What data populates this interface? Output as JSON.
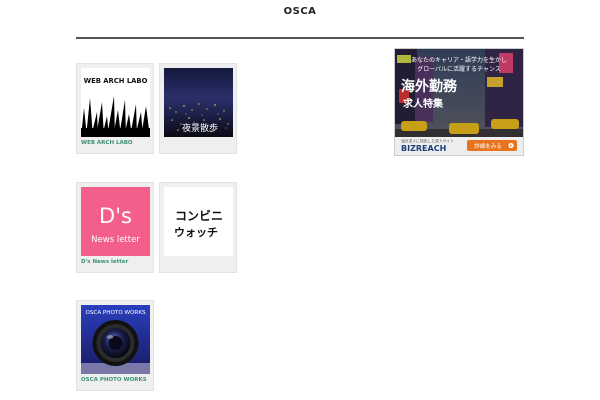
{
  "site": {
    "title": "OSCA"
  },
  "cards": [
    {
      "caption": "WEB ARCH LABO",
      "thumb_text": "WEB ARCH LABO"
    },
    {
      "caption": "",
      "thumb_text": "夜景散歩"
    },
    {
      "caption": "D's News letter",
      "thumb_big": "D's",
      "thumb_small": "News letter"
    },
    {
      "caption": "",
      "thumb_line1": "コンビニ",
      "thumb_line2": "ウォッチ"
    },
    {
      "caption": "OSCA PHOTO WORKS",
      "thumb_text": "OSCA PHOTO WORKS"
    }
  ],
  "ad": {
    "tagline1": "あなたのキャリア・語学力を生かし",
    "tagline2": "グローバルに活躍するチャンス",
    "headline": "海外勤務",
    "subhead": "求人特集",
    "footnote": "海外求人に特化した求人サイト",
    "brand": "BIZREACH",
    "cta": "詳細をみる"
  },
  "colors": {
    "caption": "#3e8f7a",
    "rule": "#555555",
    "card_bg": "#efefef",
    "pink": "#f35e8a",
    "cta": "#e8731c"
  }
}
